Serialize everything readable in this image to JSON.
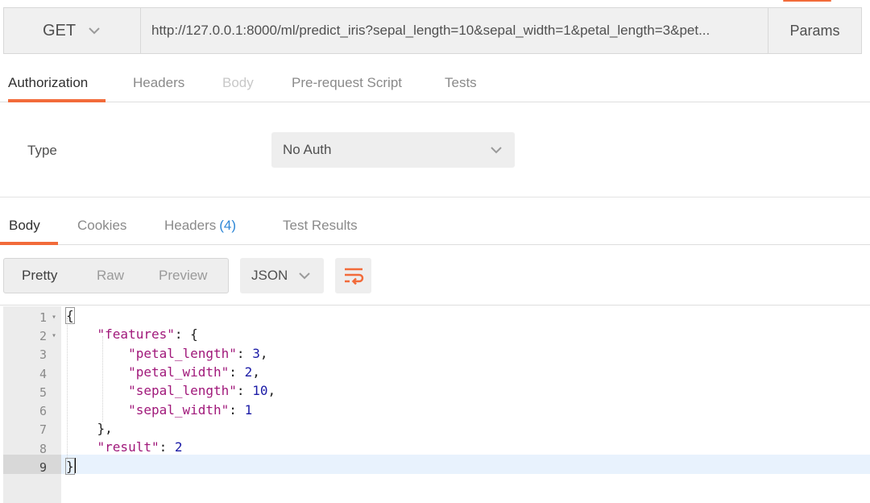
{
  "request": {
    "method": "GET",
    "url": "http://127.0.0.1:8000/ml/predict_iris?sepal_length=10&sepal_width=1&petal_length=3&pet...",
    "params_label": "Params"
  },
  "request_tabs": [
    {
      "label": "Authorization",
      "state": "active"
    },
    {
      "label": "Headers",
      "state": "normal"
    },
    {
      "label": "Body",
      "state": "disabled"
    },
    {
      "label": "Pre-request Script",
      "state": "normal"
    },
    {
      "label": "Tests",
      "state": "normal"
    }
  ],
  "auth": {
    "type_label": "Type",
    "selected": "No Auth"
  },
  "response_tabs": [
    {
      "label": "Body",
      "state": "active"
    },
    {
      "label": "Cookies",
      "state": "normal"
    },
    {
      "label": "Headers",
      "count": "(4)",
      "state": "normal"
    },
    {
      "label": "Test Results",
      "state": "normal"
    }
  ],
  "response_toolbar": {
    "views": [
      "Pretty",
      "Raw",
      "Preview"
    ],
    "active_view": "Pretty",
    "format": "JSON"
  },
  "editor": {
    "lines": [
      {
        "num": "1",
        "fold": true
      },
      {
        "num": "2",
        "fold": true
      },
      {
        "num": "3",
        "fold": false
      },
      {
        "num": "4",
        "fold": false
      },
      {
        "num": "5",
        "fold": false
      },
      {
        "num": "6",
        "fold": false
      },
      {
        "num": "7",
        "fold": false
      },
      {
        "num": "8",
        "fold": false
      },
      {
        "num": "9",
        "fold": false
      }
    ],
    "current_line": "9",
    "json": {
      "features_key": "\"features\"",
      "petal_length_key": "\"petal_length\"",
      "petal_length_value": "3",
      "petal_width_key": "\"petal_width\"",
      "petal_width_value": "2",
      "sepal_length_key": "\"sepal_length\"",
      "sepal_length_value": "10",
      "sepal_width_key": "\"sepal_width\"",
      "sepal_width_value": "1",
      "result_key": "\"result\"",
      "result_value": "2"
    }
  },
  "colors": {
    "accent": "#f26b3a",
    "json_key": "#a0187a",
    "json_number": "#1a1aa6",
    "count_blue": "#2e87d6"
  },
  "icons": {
    "method_dropdown": "chevron-down-icon",
    "auth_dropdown": "chevron-down-icon",
    "format_dropdown": "chevron-down-icon",
    "wrap": "wrap-lines-icon"
  }
}
